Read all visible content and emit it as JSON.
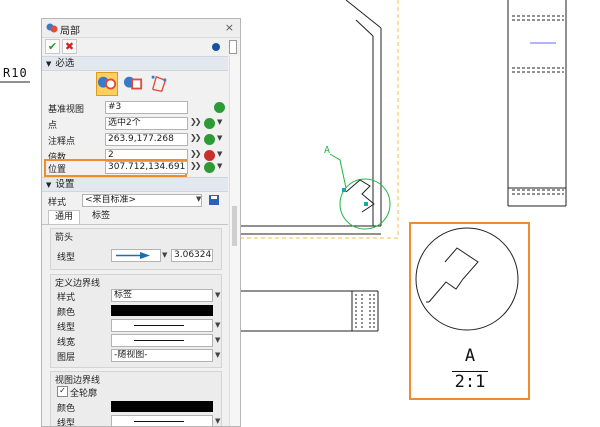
{
  "canvas": {
    "dim_label": "R10",
    "view_label": "A",
    "detail_letter": "A",
    "detail_scale": "2:1",
    "accent_orange": "#f08c2c",
    "accent_green": "#1fb544",
    "dashed_border": "#f5c040"
  },
  "panel": {
    "title": "局部",
    "close": "×",
    "toolbar": {
      "ok": "✔",
      "cancel": "✖"
    },
    "required_section": {
      "label": "必选",
      "modes": [
        "detail-circle-icon",
        "detail-rect-icon",
        "detail-polygon-icon"
      ],
      "rows": [
        {
          "label": "基准视图",
          "value": "#3",
          "chevron": false
        },
        {
          "label": "点",
          "value": "选中2个",
          "chevron": true
        },
        {
          "label": "注释点",
          "value": "263.9,177.268",
          "chevron": true
        },
        {
          "label": "倍数",
          "value": "2",
          "chevron": true
        },
        {
          "label": "位置",
          "value": "307.712,134.691",
          "chevron": true
        }
      ]
    },
    "settings_section": {
      "label": "设置",
      "style_label": "样式",
      "style_value": "<来自标准>",
      "tabs": [
        "通用",
        "标签"
      ],
      "arrow_group": {
        "title": "箭头",
        "linetype_label": "线型",
        "size": "3.06324"
      },
      "boundary_group": {
        "title": "定义边界线",
        "rows": [
          {
            "label": "样式",
            "value": "标签"
          },
          {
            "label": "颜色"
          },
          {
            "label": "线型"
          },
          {
            "label": "线宽"
          },
          {
            "label": "图层",
            "value": "-随视图-"
          }
        ]
      },
      "view_boundary_group": {
        "title": "视图边界线",
        "full_outline_label": "全轮廓",
        "full_outline_checked": true,
        "rows": [
          {
            "label": "颜色"
          },
          {
            "label": "线型"
          }
        ]
      }
    }
  }
}
